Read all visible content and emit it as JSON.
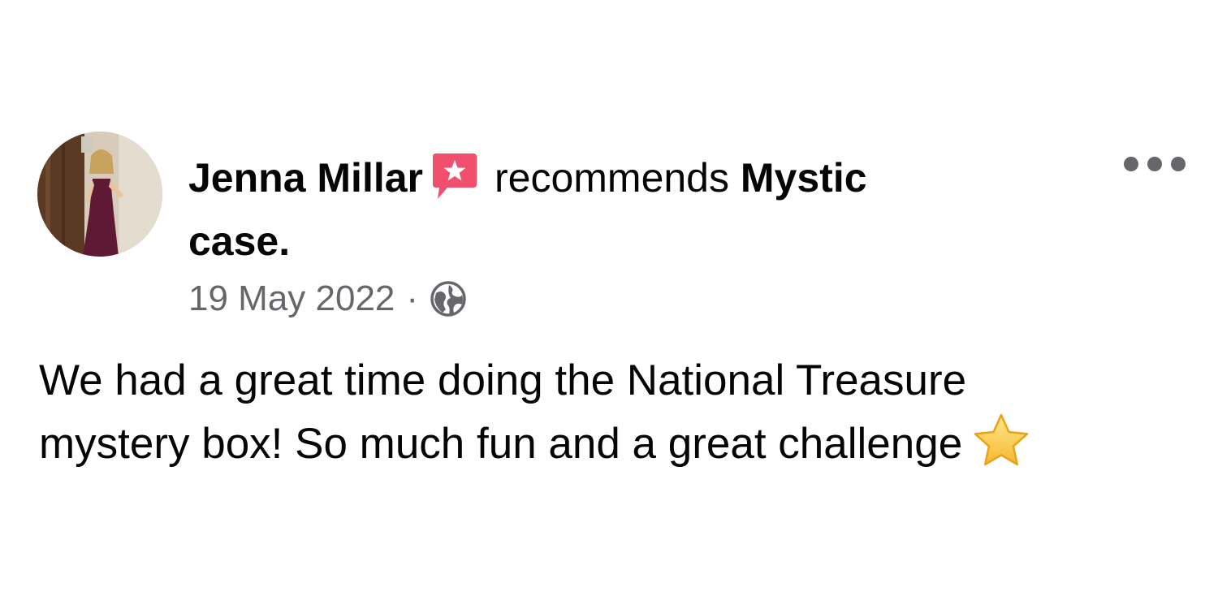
{
  "post": {
    "author_name": "Jenna Millar",
    "recommends_text": "recommends",
    "page_name_line1": "Mystic",
    "page_name_line2": "case.",
    "date": "19 May 2022",
    "separator": "·",
    "privacy_icon": "globe-icon",
    "recommend_icon": "recommend-star-bubble-icon",
    "more_icon": "more-options-icon",
    "body_line1": "We had a great time doing the National Treasure",
    "body_line2": "mystery box! So much fun and a great challenge",
    "emoji": "star-emoji"
  },
  "colors": {
    "text_primary": "#050505",
    "text_secondary": "#65676b",
    "recommend_badge": "#f0506e",
    "background": "#ffffff"
  }
}
